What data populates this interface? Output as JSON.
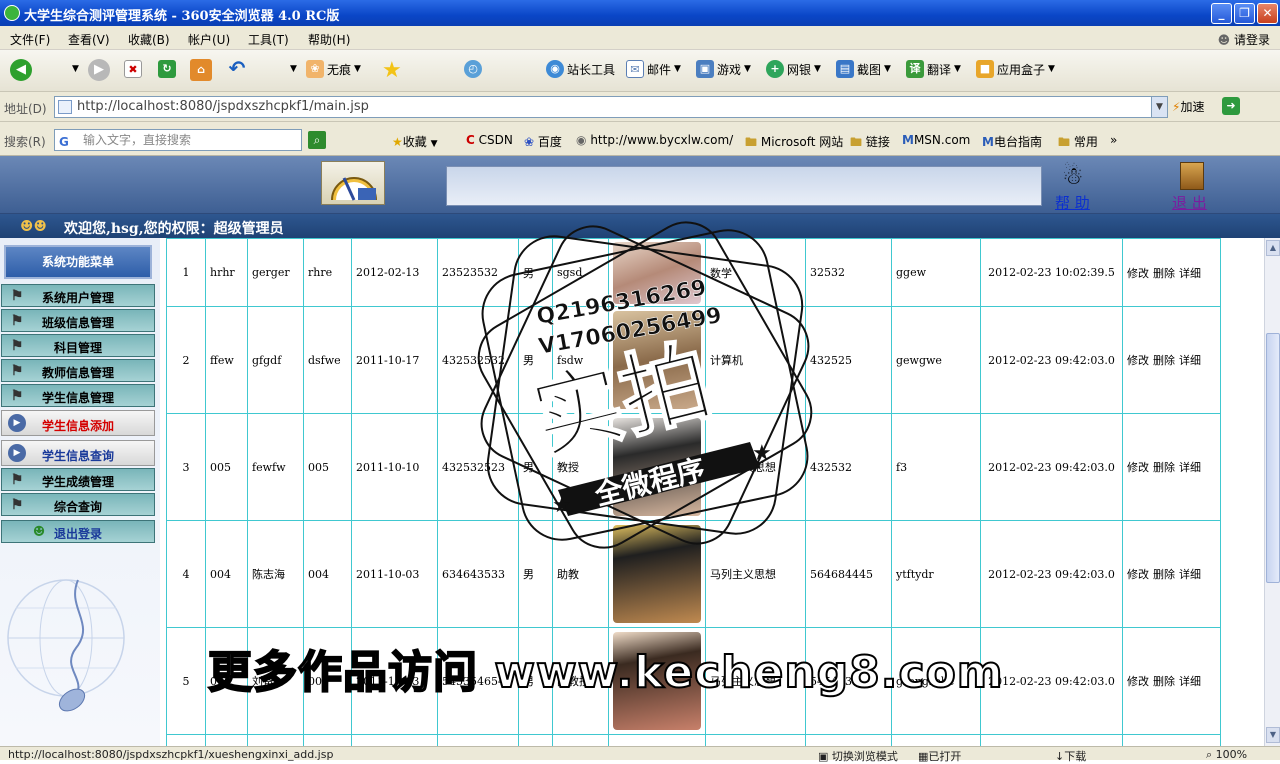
{
  "window": {
    "title": "大学生综合测评管理系统 - 360安全浏览器 4.0 RC版",
    "btn_min": "_",
    "btn_max": "❐",
    "btn_close": "✕"
  },
  "menubar": {
    "items": [
      "文件(F)",
      "查看(V)",
      "收藏(B)",
      "帐户(U)",
      "工具(T)",
      "帮助(H)"
    ],
    "login": "请登录"
  },
  "toolbar": {
    "incognito": "无痕",
    "webmaster": "站长工具",
    "mail": "邮件",
    "games": "游戏",
    "bank": "网银",
    "screenshot": "截图",
    "translate": "翻译",
    "appbox": "应用盒子"
  },
  "addressbar": {
    "label": "地址(D)",
    "url": "http://localhost:8080/jspdxszhcpkf1/main.jsp",
    "accelerate": "加速"
  },
  "searchbar": {
    "label": "搜索(R)",
    "placeholder": "输入文字，直接搜索",
    "favorites": "收藏",
    "links": [
      "CSDN",
      "百度",
      "http://www.bycxlw.com/",
      "Microsoft 网站",
      "链接",
      "MSN.com",
      "电台指南",
      "常用"
    ],
    "more": "»"
  },
  "header": {
    "help": "帮 助",
    "logout": "退 出"
  },
  "welcome": "欢迎您,hsg,您的权限：超级管理员",
  "sidebar": {
    "title": "系统功能菜单",
    "items": [
      "系统用户管理",
      "班级信息管理",
      "科目管理",
      "教师信息管理",
      "学生信息管理",
      "学生信息添加",
      "学生信息查询",
      "学生成绩管理",
      "综合查询",
      "退出登录"
    ]
  },
  "table": {
    "rows": [
      {
        "no": "1",
        "id": "hrhr",
        "name": "gerger",
        "pwd": "rhre",
        "date": "2012-02-13",
        "phone": "23523532",
        "sex": "男",
        "title": "sgsd",
        "dept": "数学",
        "code": "32532",
        "remark": "ggew",
        "time": "2012-02-23 10:02:39.5"
      },
      {
        "no": "2",
        "id": "ffew",
        "name": "gfgdf",
        "pwd": "dsfwe",
        "date": "2011-10-17",
        "phone": "432532532",
        "sex": "男",
        "title": "fsdw",
        "dept": "计算机",
        "code": "432525",
        "remark": "gewgwe",
        "time": "2012-02-23 09:42:03.0"
      },
      {
        "no": "3",
        "id": "005",
        "name": "fewfw",
        "pwd": "005",
        "date": "2011-10-10",
        "phone": "432532523",
        "sex": "男",
        "title": "教授",
        "dept": "马列主义思想",
        "code": "432532",
        "remark": "f3",
        "time": "2012-02-23 09:42:03.0"
      },
      {
        "no": "4",
        "id": "004",
        "name": "陈志海",
        "pwd": "004",
        "date": "2011-10-03",
        "phone": "634643533",
        "sex": "男",
        "title": "助教",
        "dept": "马列主义思想",
        "code": "564684445",
        "remark": "ytftydr",
        "time": "2012-02-23 09:42:03.0"
      },
      {
        "no": "5",
        "id": "003",
        "name": "刘备",
        "pwd": "003",
        "date": "2011-10-03",
        "phone": "545354654",
        "sex": "男",
        "title": "副教授",
        "dept": "马列主义思想",
        "code": "545433",
        "remark": "grengrehe",
        "time": "2012-02-23 09:42:03.0"
      }
    ],
    "actions": {
      "edit": "修改",
      "delete": "删除",
      "detail": "详细"
    }
  },
  "statusbar": {
    "link": "http://localhost:8080/jspdxszhcpkf1/xueshengxinxi_add.jsp",
    "mode": "切换浏览模式",
    "open": "已打开",
    "download": "下载",
    "zoom": "100%"
  },
  "overlay": {
    "qq": "Q2196316269",
    "wechat": "V17060256499",
    "stamp_main": "实拍",
    "stamp_sub": "全微程序",
    "watermark": "更多作品访问 www.kecheng8.com"
  }
}
